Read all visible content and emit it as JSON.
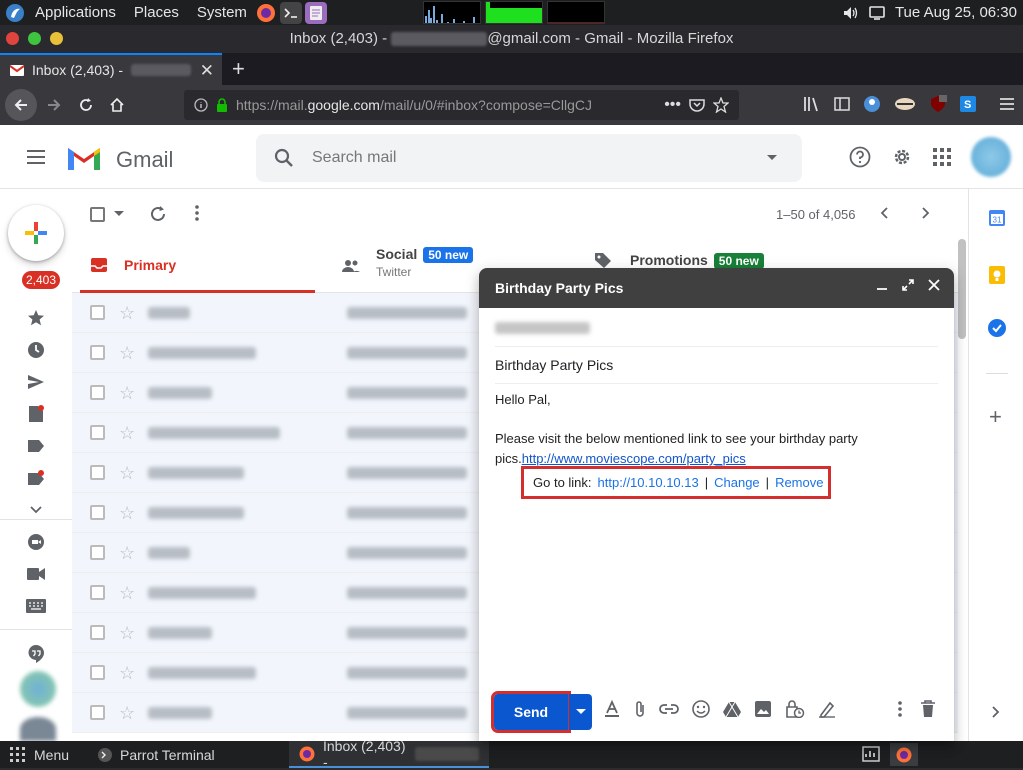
{
  "os_panel": {
    "menus": [
      "Applications",
      "Places",
      "System"
    ],
    "clock": "Tue Aug 25, 06:30"
  },
  "window": {
    "title_prefix": "Inbox (2,403) - ",
    "title_suffix": "@gmail.com - Gmail - Mozilla Firefox"
  },
  "tab": {
    "label": "Inbox (2,403) -"
  },
  "urlbar": {
    "scheme": "https://mail.",
    "host": "google.com",
    "path": "/mail/u/0/#inbox?compose=CllgCJ"
  },
  "gmail": {
    "brand": "Gmail",
    "search_placeholder": "Search mail",
    "inbox_count": "2,403",
    "range": "1–50 of 4,056",
    "tabs": [
      {
        "label": "Primary"
      },
      {
        "label": "Social",
        "badge": "50 new",
        "sub": "Twitter"
      },
      {
        "label": "Promotions",
        "badge": "50 new"
      }
    ],
    "row_count": 11
  },
  "compose": {
    "title": "Birthday Party Pics",
    "subject": "Birthday Party Pics",
    "body_greeting": "Hello Pal,",
    "body_text": "Please visit the below mentioned link to see your birthday party pics.",
    "body_link": "http://www.moviescope.com/party_pics",
    "link_popup": {
      "label": "Go to link:",
      "url": "http://10.10.10.13",
      "sep": "|",
      "change": "Change",
      "remove": "Remove"
    },
    "send_label": "Send"
  },
  "taskbar": {
    "menu": "Menu",
    "terminal": "Parrot Terminal",
    "firefox": "Inbox (2,403) -"
  },
  "colors": {
    "gmail_red": "#d93025",
    "send_blue": "#0b57d0",
    "highlight_red": "#d32f2f",
    "badge_blue": "#1a73e8",
    "badge_green": "#188038"
  }
}
